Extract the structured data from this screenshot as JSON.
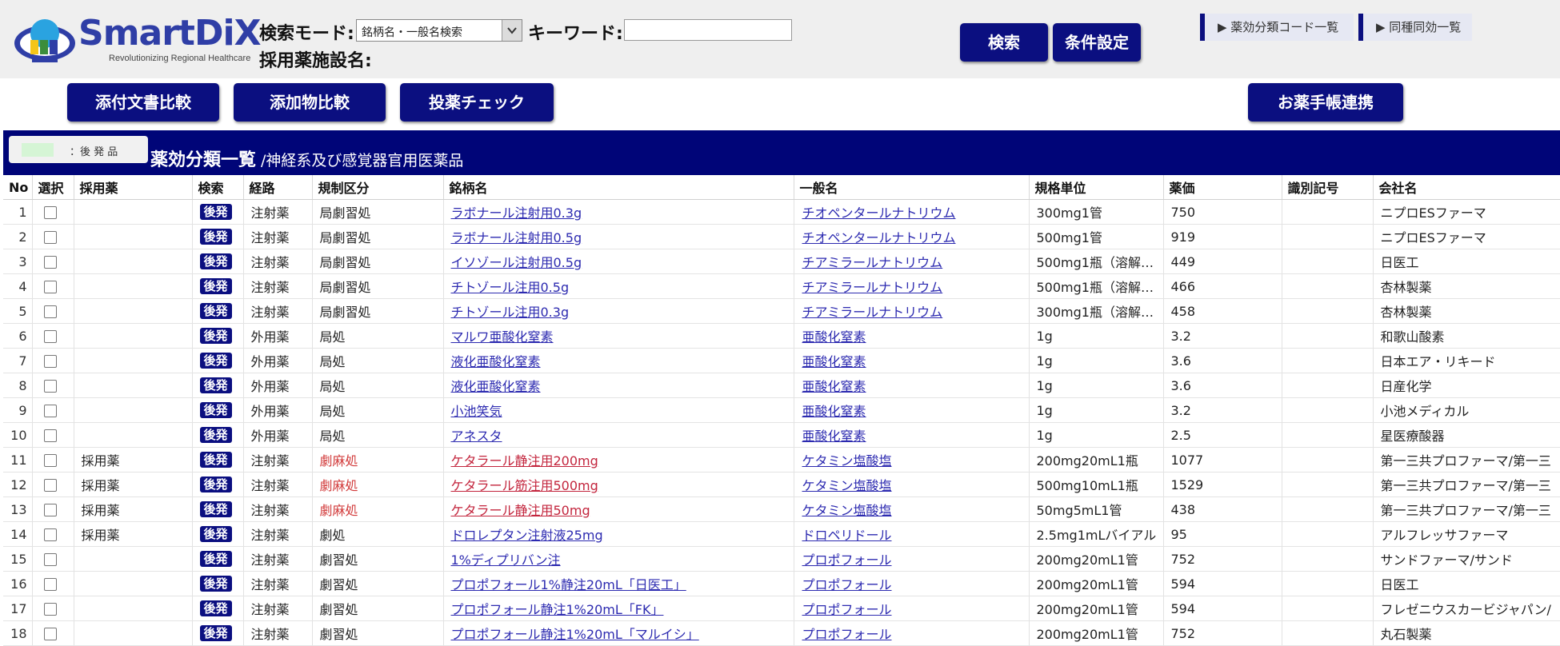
{
  "header": {
    "logo_text": "SmartDiX",
    "logo_subtitle": "Revolutionizing Regional Healthcare",
    "search_mode_label": "検索モード:",
    "search_mode_value": "銘柄名・一般名検索",
    "keyword_label": "キーワード:",
    "facility_label": "採用薬施設名:",
    "search_button": "検索",
    "conditions_button": "条件設定",
    "link_code_list": "▶ 薬効分類コード一覧",
    "link_same_kind": "▶ 同種同効一覧"
  },
  "toolbar": {
    "compare_docs": "添付文書比較",
    "compare_additives": "添加物比較",
    "dosing_check": "投薬チェック",
    "handbook": "お薬手帳連携"
  },
  "legend": {
    "label": "：後 発 品",
    "swatch_color": "#d5f5d5"
  },
  "section": {
    "title": "薬効分類一覧",
    "subtitle": "/神経系及び感覚器官用医薬品"
  },
  "table": {
    "headers": {
      "no": "No",
      "select": "選択",
      "adopted": "採用薬",
      "search": "検索",
      "route": "経路",
      "regulation": "規制区分",
      "brand": "銘柄名",
      "generic": "一般名",
      "unit": "規格単位",
      "price": "薬価",
      "code": "識別記号",
      "company": "会社名"
    },
    "generic_badge": "後発",
    "rows": [
      {
        "no": "1",
        "adopted": "",
        "route": "注射薬",
        "regulation": "局劇習処",
        "brand": "ラボナール注射用0.3g",
        "generic": "チオペンタールナトリウム",
        "unit": "300mg1管",
        "price": "750",
        "code": "",
        "company": "ニプロESファーマ"
      },
      {
        "no": "2",
        "adopted": "",
        "route": "注射薬",
        "regulation": "局劇習処",
        "brand": "ラボナール注射用0.5g",
        "generic": "チオペンタールナトリウム",
        "unit": "500mg1管",
        "price": "919",
        "code": "",
        "company": "ニプロESファーマ"
      },
      {
        "no": "3",
        "adopted": "",
        "route": "注射薬",
        "regulation": "局劇習処",
        "brand": "イソゾール注射用0.5g",
        "generic": "チアミラールナトリウム",
        "unit": "500mg1瓶（溶解…",
        "price": "449",
        "code": "",
        "company": "日医工"
      },
      {
        "no": "4",
        "adopted": "",
        "route": "注射薬",
        "regulation": "局劇習処",
        "brand": "チトゾール注用0.5g",
        "generic": "チアミラールナトリウム",
        "unit": "500mg1瓶（溶解…",
        "price": "466",
        "code": "",
        "company": "杏林製薬"
      },
      {
        "no": "5",
        "adopted": "",
        "route": "注射薬",
        "regulation": "局劇習処",
        "brand": "チトゾール注用0.3g",
        "generic": "チアミラールナトリウム",
        "unit": "300mg1瓶（溶解…",
        "price": "458",
        "code": "",
        "company": "杏林製薬"
      },
      {
        "no": "6",
        "adopted": "",
        "route": "外用薬",
        "regulation": "局処",
        "brand": "マルワ亜酸化窒素",
        "generic": "亜酸化窒素",
        "unit": "1g",
        "price": "3.2",
        "code": "",
        "company": "和歌山酸素"
      },
      {
        "no": "7",
        "adopted": "",
        "route": "外用薬",
        "regulation": "局処",
        "brand": "液化亜酸化窒素",
        "generic": "亜酸化窒素",
        "unit": "1g",
        "price": "3.6",
        "code": "",
        "company": "日本エア・リキード"
      },
      {
        "no": "8",
        "adopted": "",
        "route": "外用薬",
        "regulation": "局処",
        "brand": "液化亜酸化窒素",
        "generic": "亜酸化窒素",
        "unit": "1g",
        "price": "3.6",
        "code": "",
        "company": "日産化学"
      },
      {
        "no": "9",
        "adopted": "",
        "route": "外用薬",
        "regulation": "局処",
        "brand": "小池笑気",
        "generic": "亜酸化窒素",
        "unit": "1g",
        "price": "3.2",
        "code": "",
        "company": "小池メディカル"
      },
      {
        "no": "10",
        "adopted": "",
        "route": "外用薬",
        "regulation": "局処",
        "brand": "アネスタ",
        "generic": "亜酸化窒素",
        "unit": "1g",
        "price": "2.5",
        "code": "",
        "company": "星医療酸器"
      },
      {
        "no": "11",
        "adopted": "採用薬",
        "route": "注射薬",
        "regulation": "劇麻処",
        "brand": "ケタラール静注用200mg",
        "generic": "ケタミン塩酸塩",
        "unit": "200mg20mL1瓶",
        "price": "1077",
        "code": "",
        "company": "第一三共プロファーマ/第一三"
      },
      {
        "no": "12",
        "adopted": "採用薬",
        "route": "注射薬",
        "regulation": "劇麻処",
        "brand": "ケタラール筋注用500mg",
        "generic": "ケタミン塩酸塩",
        "unit": "500mg10mL1瓶",
        "price": "1529",
        "code": "",
        "company": "第一三共プロファーマ/第一三"
      },
      {
        "no": "13",
        "adopted": "採用薬",
        "route": "注射薬",
        "regulation": "劇麻処",
        "brand": "ケタラール静注用50mg",
        "generic": "ケタミン塩酸塩",
        "unit": "50mg5mL1管",
        "price": "438",
        "code": "",
        "company": "第一三共プロファーマ/第一三"
      },
      {
        "no": "14",
        "adopted": "採用薬",
        "route": "注射薬",
        "regulation": "劇処",
        "brand": "ドロレプタン注射液25mg",
        "generic": "ドロペリドール",
        "unit": "2.5mg1mLバイアル",
        "price": "95",
        "code": "",
        "company": "アルフレッサファーマ"
      },
      {
        "no": "15",
        "adopted": "",
        "route": "注射薬",
        "regulation": "劇習処",
        "brand": "1%ディプリバン注",
        "generic": "プロポフォール",
        "unit": "200mg20mL1管",
        "price": "752",
        "code": "",
        "company": "サンドファーマ/サンド"
      },
      {
        "no": "16",
        "adopted": "",
        "route": "注射薬",
        "regulation": "劇習処",
        "brand": "プロポフォール1%静注20mL「日医工」",
        "generic": "プロポフォール",
        "unit": "200mg20mL1管",
        "price": "594",
        "code": "",
        "company": "日医工"
      },
      {
        "no": "17",
        "adopted": "",
        "route": "注射薬",
        "regulation": "劇習処",
        "brand": "プロポフォール静注1%20mL「FK」",
        "generic": "プロポフォール",
        "unit": "200mg20mL1管",
        "price": "594",
        "code": "",
        "company": "フレゼニウスカービジャパン/"
      },
      {
        "no": "18",
        "adopted": "",
        "route": "注射薬",
        "regulation": "劇習処",
        "brand": "プロポフォール静注1%20mL「マルイシ」",
        "generic": "プロポフォール",
        "unit": "200mg20mL1管",
        "price": "752",
        "code": "",
        "company": "丸石製薬"
      }
    ]
  }
}
